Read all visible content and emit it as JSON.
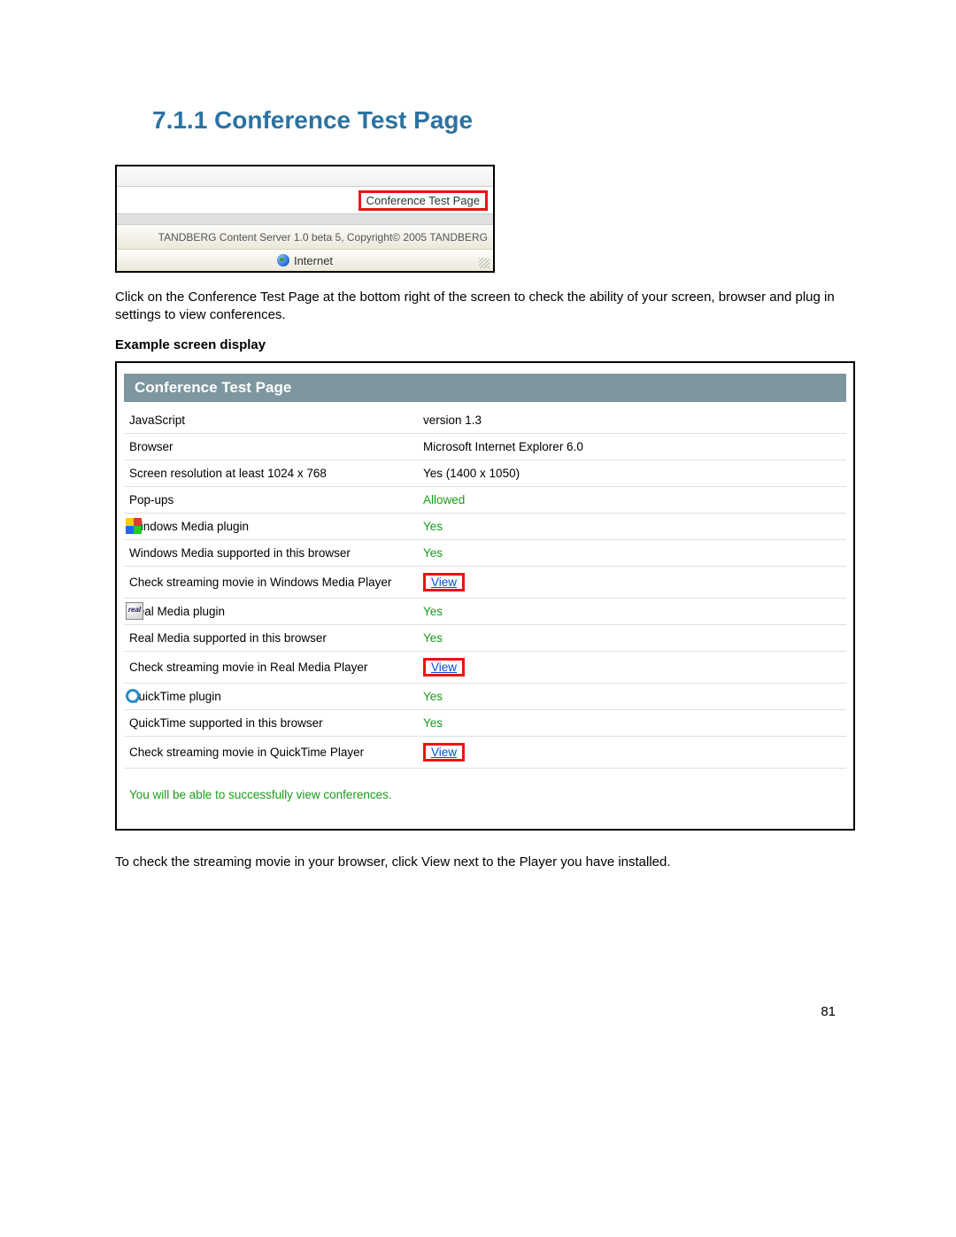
{
  "heading": "7.1.1  Conference Test Page",
  "shot1": {
    "link_label": "Conference Test Page",
    "footer_text": "TANDBERG Content Server 1.0 beta 5, Copyright© 2005 TANDBERG",
    "zone_label": "Internet"
  },
  "para1": "Click on the Conference Test Page at the bottom right of the screen to check the ability of your screen, browser and plug in settings to view conferences.",
  "subheading": "Example screen display",
  "panel_title": "Conference Test Page",
  "rows": [
    {
      "label": "JavaScript",
      "value": "version 1.3"
    },
    {
      "label": "Browser",
      "value": "Microsoft Internet Explorer 6.0"
    },
    {
      "label": "Screen resolution at least 1024 x 768",
      "value": "Yes (1400 x 1050)"
    },
    {
      "label": "Pop-ups",
      "value": "Allowed",
      "green": true
    },
    {
      "label": "Windows Media plugin",
      "value": "Yes",
      "green": true,
      "icon": "wm"
    },
    {
      "label": "Windows Media supported in this browser",
      "value": "Yes",
      "green": true
    },
    {
      "label": "Check streaming movie in Windows Media Player",
      "value": "View",
      "view": true
    },
    {
      "label": "Real Media plugin",
      "value": "Yes",
      "green": true,
      "icon": "real"
    },
    {
      "label": "Real Media supported in this browser",
      "value": "Yes",
      "green": true
    },
    {
      "label": "Check streaming movie in Real Media Player",
      "value": "View",
      "view": true
    },
    {
      "label": "QuickTime plugin",
      "value": "Yes",
      "green": true,
      "icon": "qt"
    },
    {
      "label": "QuickTime supported in this browser",
      "value": "Yes",
      "green": true
    },
    {
      "label": "Check streaming movie in QuickTime Player",
      "value": "View",
      "view": true
    }
  ],
  "success_message": "You will be able to successfully view conferences.",
  "para2": "To check the streaming movie in your browser, click View next to the Player you have installed.",
  "page_number": "81"
}
